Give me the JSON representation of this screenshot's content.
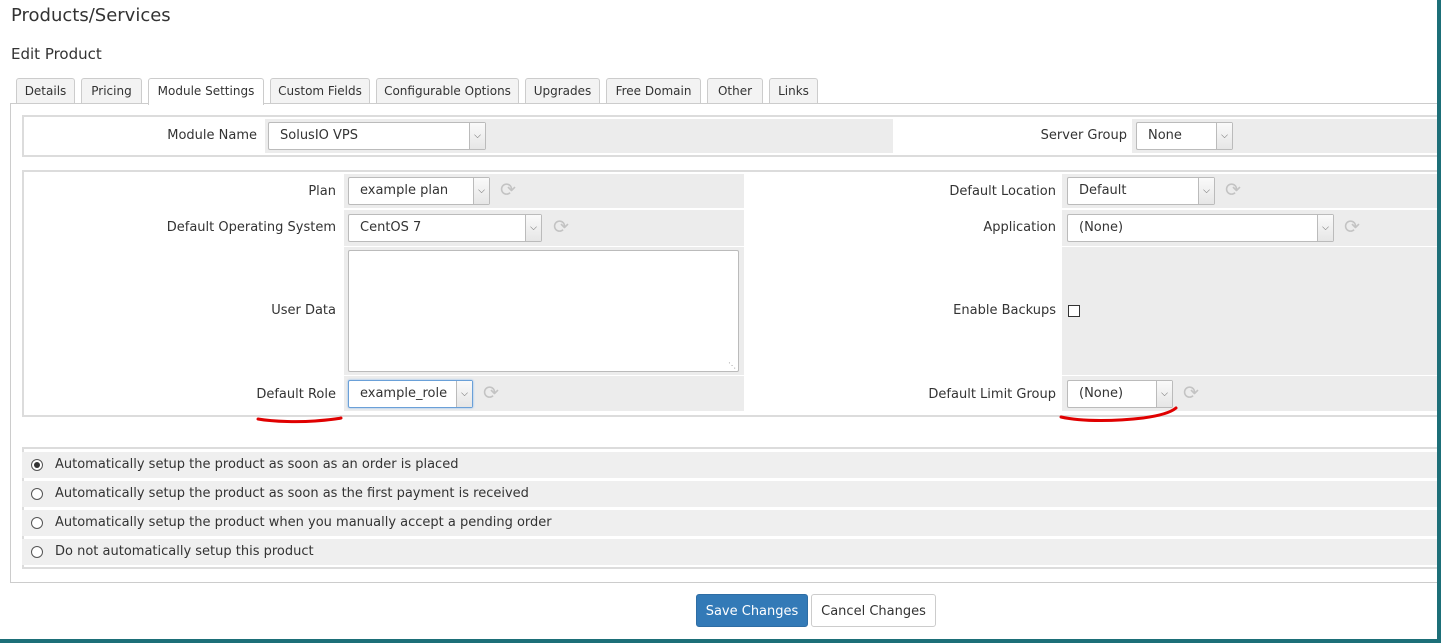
{
  "header": {
    "title": "Products/Services",
    "subtitle": "Edit Product"
  },
  "tabs": [
    {
      "label": "Details"
    },
    {
      "label": "Pricing"
    },
    {
      "label": "Module Settings",
      "active": true
    },
    {
      "label": "Custom Fields"
    },
    {
      "label": "Configurable Options"
    },
    {
      "label": "Upgrades"
    },
    {
      "label": "Free Domain"
    },
    {
      "label": "Other"
    },
    {
      "label": "Links"
    }
  ],
  "module": {
    "name_label": "Module Name",
    "name_value": "SolusIO VPS",
    "server_group_label": "Server Group",
    "server_group_value": "None"
  },
  "settings": {
    "plan_label": "Plan",
    "plan_value": "example plan",
    "os_label": "Default Operating System",
    "os_value": "CentOS 7",
    "user_data_label": "User Data",
    "user_data_value": "",
    "role_label": "Default Role",
    "role_value": "example_role",
    "location_label": "Default Location",
    "location_value": "Default",
    "application_label": "Application",
    "application_value": "(None)",
    "backups_label": "Enable Backups",
    "backups_checked": false,
    "limit_group_label": "Default Limit Group",
    "limit_group_value": "(None)"
  },
  "setup_options": [
    {
      "label": "Automatically setup the product as soon as an order is placed",
      "checked": true
    },
    {
      "label": "Automatically setup the product as soon as the first payment is received",
      "checked": false
    },
    {
      "label": "Automatically setup the product when you manually accept a pending order",
      "checked": false
    },
    {
      "label": "Do not automatically setup this product",
      "checked": false
    }
  ],
  "actions": {
    "save_label": "Save Changes",
    "cancel_label": "Cancel Changes"
  },
  "colors": {
    "primary": "#337ab7",
    "annotation": "#e00000",
    "accent_bar": "#1d6f78"
  },
  "icons": {
    "refresh": "refresh-icon",
    "dropdown": "chevron-down-icon"
  }
}
